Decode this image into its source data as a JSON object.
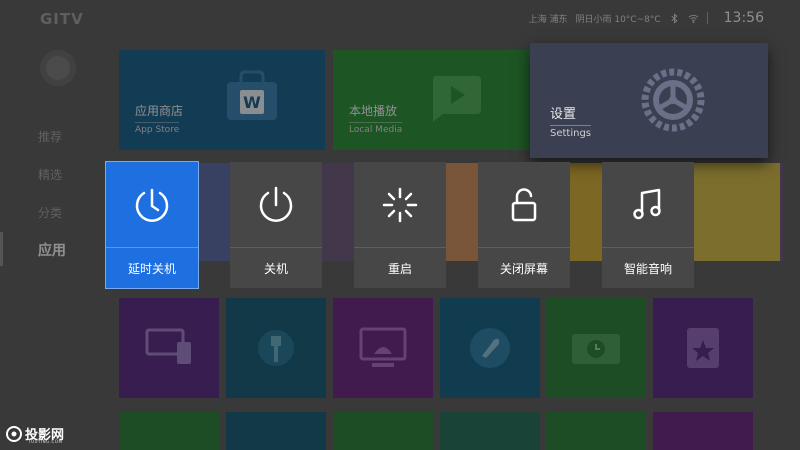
{
  "header": {
    "logo": "GITV",
    "location": "上海 浦东",
    "weather": "阴日小雨 10°C~8°C",
    "time": "13:56"
  },
  "sidebar": {
    "items": [
      {
        "label": "推荐"
      },
      {
        "label": "精选"
      },
      {
        "label": "分类"
      },
      {
        "label": "应用"
      }
    ]
  },
  "tiles": {
    "app_store": {
      "title": "应用商店",
      "subtitle": "App Store"
    },
    "local_media": {
      "title": "本地播放",
      "subtitle": "Local Media"
    },
    "settings": {
      "title": "设置",
      "subtitle": "Settings"
    }
  },
  "power_menu": {
    "items": [
      {
        "label": "延时关机",
        "icon": "timer-power-icon"
      },
      {
        "label": "关机",
        "icon": "power-icon"
      },
      {
        "label": "重启",
        "icon": "restart-spinner-icon"
      },
      {
        "label": "关闭屏幕",
        "icon": "unlock-icon"
      },
      {
        "label": "智能音响",
        "icon": "music-note-icon"
      }
    ]
  },
  "watermark": {
    "text": "投影网",
    "sub": "TOUYING.COM"
  },
  "colors": {
    "selected": "#1e6fe0",
    "menu_bg": "#474747"
  }
}
